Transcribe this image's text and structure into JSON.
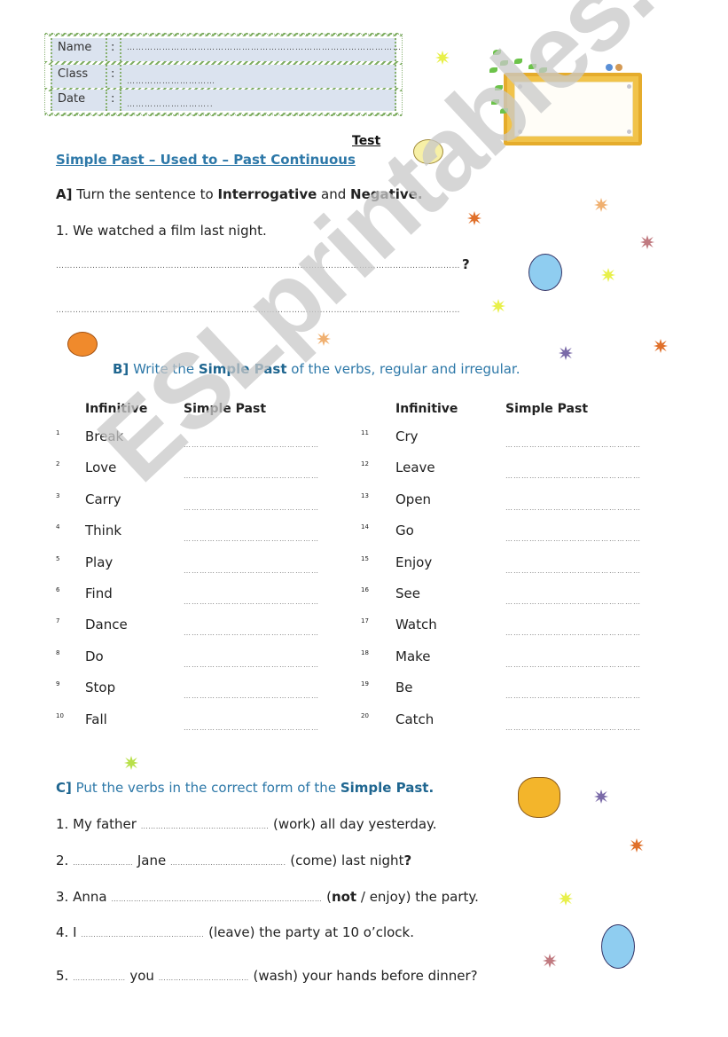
{
  "header": {
    "fields": [
      {
        "label": "Name",
        "sep": ":",
        "dots": "…………………………………………………………………………………"
      },
      {
        "label": "Class",
        "sep": ":",
        "dots": "…………………………"
      },
      {
        "label": "Date",
        "sep": ":",
        "dots": "……………………….."
      }
    ]
  },
  "test_label": "Test",
  "title": "Simple Past – Used to – Past Continuous",
  "section_a": {
    "marker": "A]",
    "text1": " Turn the sentence to ",
    "bold1": "Interrogative",
    "text2": " and ",
    "bold2": "Negative",
    "text3": ".",
    "question": "1. We watched a film last night.",
    "answer_lines": [
      "…………………………………………………………………………………………………………………………………………",
      "…………………………………………………………………………………………………………………………………………"
    ],
    "qmark": "?"
  },
  "section_b": {
    "marker": "B]",
    "text1": " Write the ",
    "bold": "Simple Past",
    "text2": " of the verbs, regular and irregular.",
    "col_infinitive": "Infinitive",
    "col_simple_past": "Simple Past",
    "answer_dots": "……………………………………………",
    "left": [
      {
        "n": "1",
        "verb": "Break"
      },
      {
        "n": "2",
        "verb": "Love"
      },
      {
        "n": "3",
        "verb": "Carry"
      },
      {
        "n": "4",
        "verb": "Think"
      },
      {
        "n": "5",
        "verb": "Play"
      },
      {
        "n": "6",
        "verb": "Find"
      },
      {
        "n": "7",
        "verb": "Dance"
      },
      {
        "n": "8",
        "verb": "Do"
      },
      {
        "n": "9",
        "verb": "Stop"
      },
      {
        "n": "10",
        "verb": "Fall"
      }
    ],
    "right": [
      {
        "n": "11",
        "verb": "Cry"
      },
      {
        "n": "12",
        "verb": "Leave"
      },
      {
        "n": "13",
        "verb": "Open"
      },
      {
        "n": "14",
        "verb": "Go"
      },
      {
        "n": "15",
        "verb": "Enjoy"
      },
      {
        "n": "16",
        "verb": "See"
      },
      {
        "n": "17",
        "verb": "Watch"
      },
      {
        "n": "18",
        "verb": "Make"
      },
      {
        "n": "19",
        "verb": "Be"
      },
      {
        "n": "20",
        "verb": "Catch"
      }
    ]
  },
  "section_c": {
    "marker": "C]",
    "text1": " Put the verbs in the correct form of the ",
    "bold": "Simple Past",
    "text2": ".",
    "items": [
      {
        "pre": "1. My father ",
        "dots1": "……………………………………………",
        "mid": "",
        "dots2": "",
        "post": " (work) all day yesterday."
      },
      {
        "pre": "2. ",
        "dots1": "……………………",
        "mid": " Jane ",
        "dots2": "……………………………………….",
        "post": " (come) last night",
        "end_bold": "?"
      },
      {
        "pre": "3. Anna ",
        "dots1": "…………………………………………………………………………",
        "mid": "",
        "dots2": "",
        "post_open": " (",
        "post_bold": "not",
        "post": " / enjoy) the party."
      },
      {
        "pre": "4. I ",
        "dots1": "………………………………………….",
        "mid": "",
        "dots2": "",
        "post": " (leave) the party at 10 o’clock."
      },
      {
        "pre": "5. ",
        "dots1": "…………………",
        "mid": " you ",
        "dots2": "………………………………",
        "post": " (wash) your hands before dinner?"
      }
    ]
  },
  "watermark": "ESLprintables.com",
  "colors": {
    "accent_blue": "#2d78a8",
    "header_fill": "#dbe3ef",
    "header_border": "#87b06e",
    "sign": "#f1c34a"
  }
}
